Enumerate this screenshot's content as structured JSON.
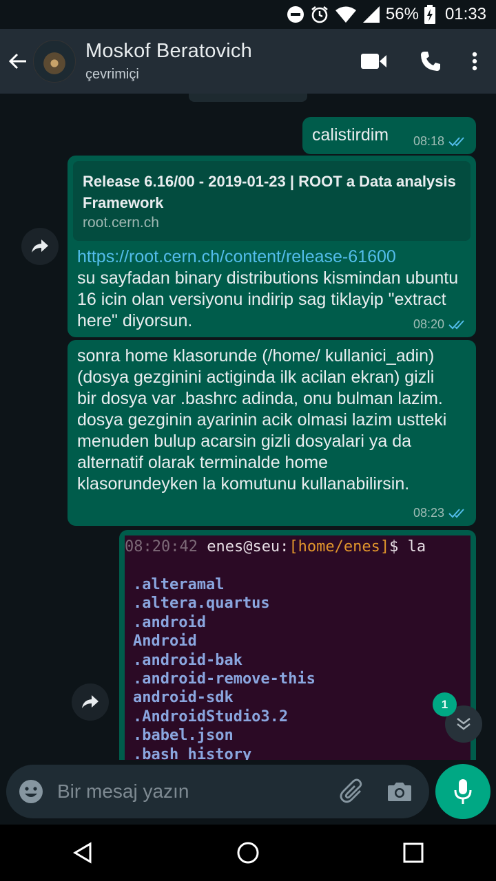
{
  "status_bar": {
    "battery": "56%",
    "time": "01:33",
    "icons": [
      "do-not-disturb-icon",
      "alarm-icon",
      "wifi-icon",
      "signal-icon",
      "battery-charging-icon"
    ]
  },
  "header": {
    "contact_name": "Moskof Beratovich",
    "contact_status": "çevrimiçi",
    "icons": [
      "back-arrow-icon",
      "video-call-icon",
      "phone-icon",
      "more-vert-icon"
    ]
  },
  "messages": [
    {
      "text": "calistirdim",
      "time": "08:18"
    },
    {
      "preview_title": "Release 6.16/00 - 2019-01-23 | ROOT a Data analysis Framework",
      "preview_domain": "root.cern.ch",
      "link": "https://root.cern.ch/content/release-61600",
      "text": "su sayfadan binary distributions kismindan ubuntu 16 icin olan versiyonu indirip sag tiklayip \"extract here\" diyorsun.",
      "time": "08:20"
    },
    {
      "text": "sonra home klasorunde (/home/ kullanici_adin) (dosya gezginini actiginda ilk acilan ekran) gizli bir dosya var .bashrc adinda, onu bulman lazim. dosya gezginin ayarinin acik olmasi lazim ustteki menuden bulup acarsin gizli dosyalari ya da alternatif olarak terminalde home klasorundeyken la komutunu kullanabilirsin.",
      "time": "08:23"
    }
  ],
  "terminal": {
    "time": "08:20:42",
    "user": "enes@seu:",
    "path": "[home/enes]",
    "command": "$ la",
    "files": [
      ".alteramal",
      ".altera.quartus",
      ".android",
      "Android",
      ".android-bak",
      ".android-remove-this",
      "android-sdk",
      ".AndroidStudio3.2",
      ".babel.json",
      ".bash_history"
    ]
  },
  "scroll_badge": "1",
  "composer": {
    "placeholder": "Bir mesaj yazın"
  },
  "colors": {
    "outgoing_bubble": "#005c4b",
    "link": "#53bdeb",
    "accent": "#00a884",
    "read_ticks": "#53bdeb"
  }
}
